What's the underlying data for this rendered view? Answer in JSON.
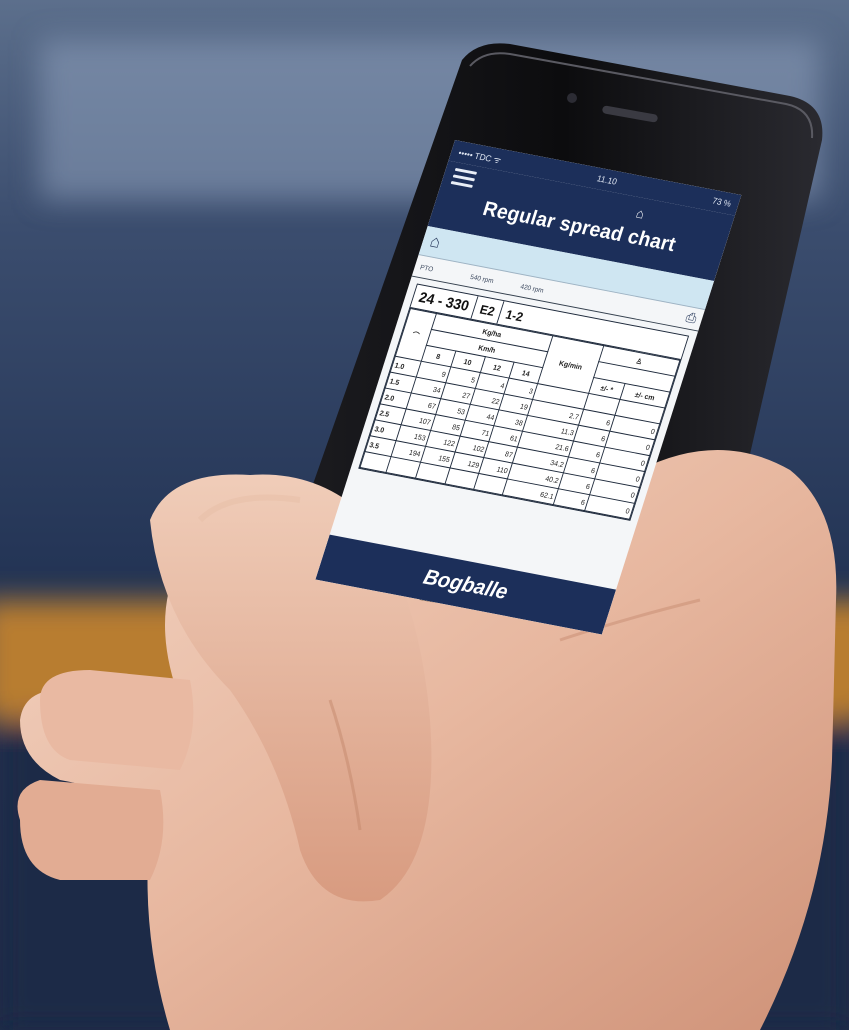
{
  "status_bar": {
    "carrier": "••••• TDC ᯤ",
    "time": "11.10",
    "battery": "73 %"
  },
  "header": {
    "title": "Regular spread chart",
    "menu_icon": "hamburger-icon",
    "home_icon": "home-icon"
  },
  "subheader": {
    "home_icon": "home-icon",
    "print_icon": "print-icon"
  },
  "pto": {
    "label": "PTO",
    "rpm_low": "540 rpm",
    "rpm_high": "420 rpm"
  },
  "spec": {
    "code": "24 - 330",
    "vane": "E2",
    "disc": "1-2"
  },
  "table": {
    "group_label": "Kg/ha",
    "speed_label": "Km/h",
    "flow_label": "Kg/min",
    "speeds": [
      "8",
      "10",
      "12",
      "14"
    ],
    "adj_headers": [
      "±/- *",
      "±/- cm"
    ],
    "rows": [
      {
        "setting": "1.0",
        "values": [
          "9",
          "5",
          "4",
          "3"
        ],
        "kgmin": "",
        "adj": [
          "",
          ""
        ]
      },
      {
        "setting": "1.5",
        "values": [
          "34",
          "27",
          "22",
          "19"
        ],
        "kgmin": "2.7",
        "adj": [
          "6",
          "0"
        ]
      },
      {
        "setting": "2.0",
        "values": [
          "67",
          "53",
          "44",
          "38"
        ],
        "kgmin": "11.3",
        "adj": [
          "6",
          "0"
        ]
      },
      {
        "setting": "2.5",
        "values": [
          "107",
          "85",
          "71",
          "61"
        ],
        "kgmin": "21.6",
        "adj": [
          "6",
          "0"
        ]
      },
      {
        "setting": "3.0",
        "values": [
          "153",
          "122",
          "102",
          "87"
        ],
        "kgmin": "34.2",
        "adj": [
          "6",
          "0"
        ]
      },
      {
        "setting": "3.5",
        "values": [
          "194",
          "155",
          "129",
          "110"
        ],
        "kgmin": "40.2",
        "adj": [
          "6",
          "0"
        ]
      },
      {
        "setting": "",
        "values": [
          "",
          "",
          "",
          ""
        ],
        "kgmin": "62.1",
        "adj": [
          "6",
          "0"
        ]
      }
    ]
  },
  "brand": {
    "name": "Bogballe"
  },
  "colors": {
    "app_navy": "#1c2f5a",
    "subheader_blue": "#cfe6f2",
    "background_blue": "#2a3a56",
    "wall_orange": "#c9852e"
  }
}
